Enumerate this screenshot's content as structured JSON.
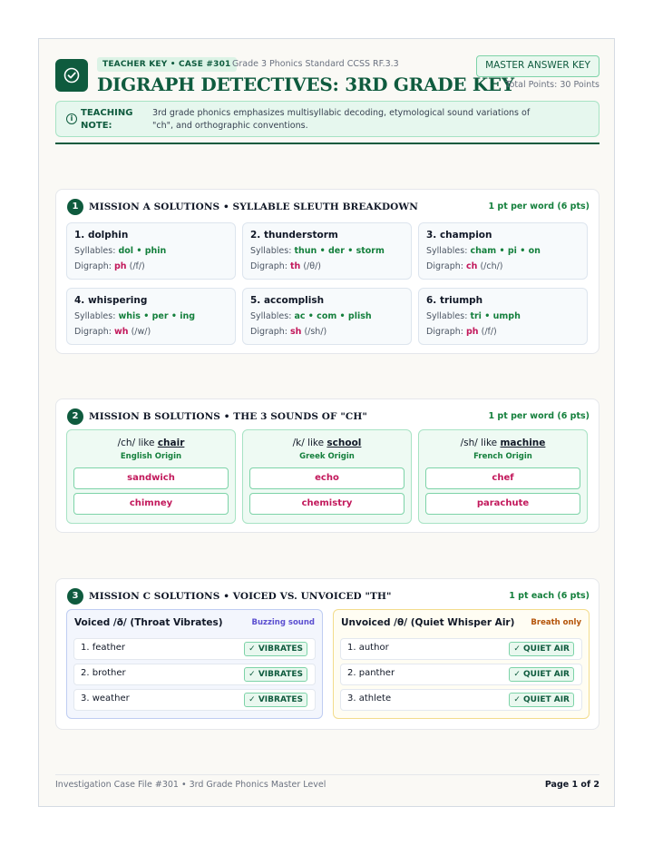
{
  "header": {
    "tag": "TEACHER KEY • CASE #301",
    "standard": "Grade 3 Phonics Standard CCSS RF.3.3",
    "title": "DIGRAPH DETECTIVES: 3RD GRADE KEY",
    "master_button": "MASTER ANSWER KEY",
    "total_points": "Total Points: 30 Points"
  },
  "note": {
    "icon": "info-icon",
    "label": "TEACHING NOTE:",
    "text": "3rd grade phonics emphasizes multisyllabic decoding, etymological sound variations of \"ch\", and orthographic conventions."
  },
  "mission_a": {
    "number": "1",
    "title": "MISSION A SOLUTIONS • SYLLABLE SLEUTH BREAKDOWN",
    "points": "1 pt per word (6 pts)",
    "syllables_label": "Syllables:",
    "digraph_label": "Digraph:",
    "words": [
      {
        "title": "1. dolphin",
        "syllables": "dol • phin",
        "digraph": "ph",
        "sound": "(/f/)"
      },
      {
        "title": "2. thunderstorm",
        "syllables": "thun • der • storm",
        "digraph": "th",
        "sound": "(/θ/)"
      },
      {
        "title": "3. champion",
        "syllables": "cham • pi • on",
        "digraph": "ch",
        "sound": "(/ch/)"
      },
      {
        "title": "4. whispering",
        "syllables": "whis • per • ing",
        "digraph": "wh",
        "sound": "(/w/)"
      },
      {
        "title": "5. accomplish",
        "syllables": "ac • com • plish",
        "digraph": "sh",
        "sound": "(/sh/)"
      },
      {
        "title": "6. triumph",
        "syllables": "tri • umph",
        "digraph": "ph",
        "sound": "(/f/)"
      }
    ]
  },
  "mission_b": {
    "number": "2",
    "title": "MISSION B SOLUTIONS • THE 3 SOUNDS OF \"CH\"",
    "points": "1 pt per word (6 pts)",
    "columns": [
      {
        "sound": "/ch/ like",
        "example": "chair",
        "origin": "English Origin",
        "answers": [
          "sandwich",
          "chimney"
        ]
      },
      {
        "sound": "/k/ like",
        "example": "school",
        "origin": "Greek Origin",
        "answers": [
          "echo",
          "chemistry"
        ]
      },
      {
        "sound": "/sh/ like",
        "example": "machine",
        "origin": "French Origin",
        "answers": [
          "chef",
          "parachute"
        ]
      }
    ]
  },
  "mission_c": {
    "number": "3",
    "title": "MISSION C SOLUTIONS • VOICED VS. UNVOICED \"TH\"",
    "points": "1 pt each (6 pts)",
    "voiced": {
      "title": "Voiced /ð/ (Throat Vibrates)",
      "hint": "Buzzing sound",
      "badge": "✓ VIBRATES",
      "words": [
        "1. feather",
        "2. brother",
        "3. weather"
      ]
    },
    "unvoiced": {
      "title": "Unvoiced /θ/ (Quiet Whisper Air)",
      "hint": "Breath only",
      "badge": "✓ QUIET AIR",
      "words": [
        "1. author",
        "2. panther",
        "3. athlete"
      ]
    }
  },
  "footer": {
    "left": "Investigation Case File #301 • 3rd Grade Phonics Master Level",
    "right": "Page 1 of 2"
  }
}
